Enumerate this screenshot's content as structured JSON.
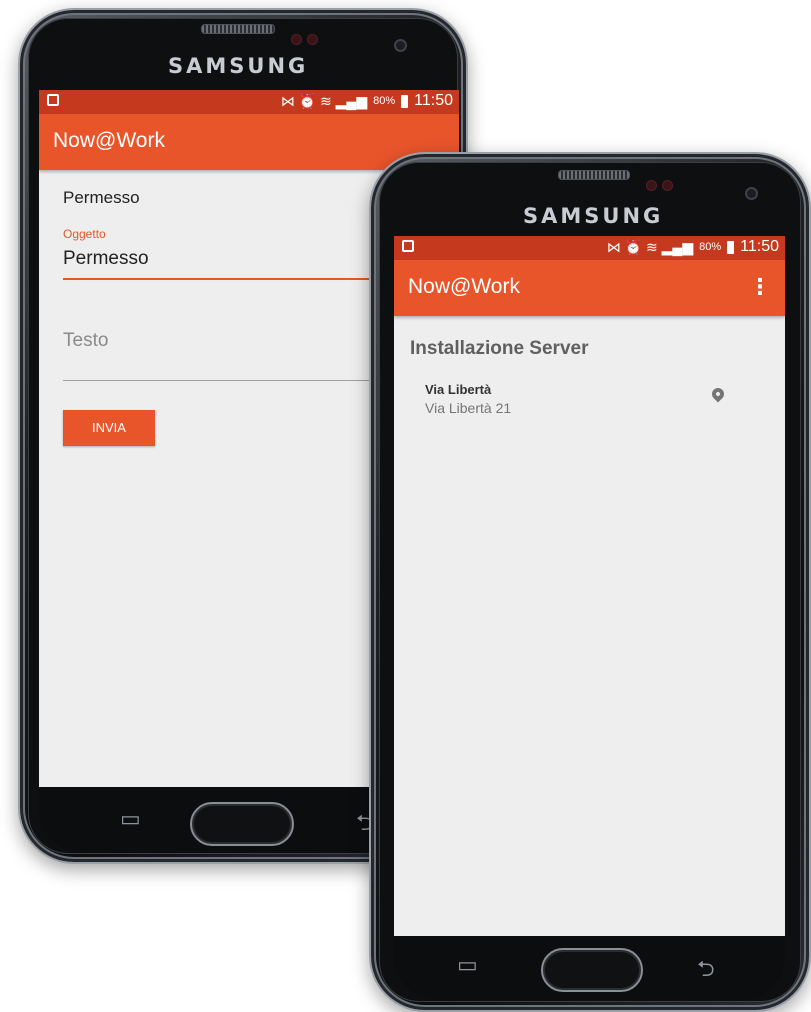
{
  "brand": "SAMSUNG",
  "status_bar": {
    "signals": "⋈ ⏰ ≋ ▂▄▆",
    "battery": "80%",
    "time": "11:50"
  },
  "app": {
    "title": "Now@Work",
    "overflow_icon": "more-vert-icon"
  },
  "form_screen": {
    "header": "Permesso",
    "subject_label": "Oggetto",
    "subject_value": "Permesso",
    "text_placeholder": "Testo",
    "send_button": "INVIA"
  },
  "list_screen": {
    "title": "Installazione Server",
    "items": [
      {
        "title": "Via Libertà",
        "subtitle": "Via Libertà 21",
        "icon": "location-pin-icon"
      }
    ]
  },
  "colors": {
    "status_bar": "#c53a1e",
    "app_bar": "#e9552b",
    "accent": "#e9552b",
    "screen_bg": "#eeeeee"
  }
}
